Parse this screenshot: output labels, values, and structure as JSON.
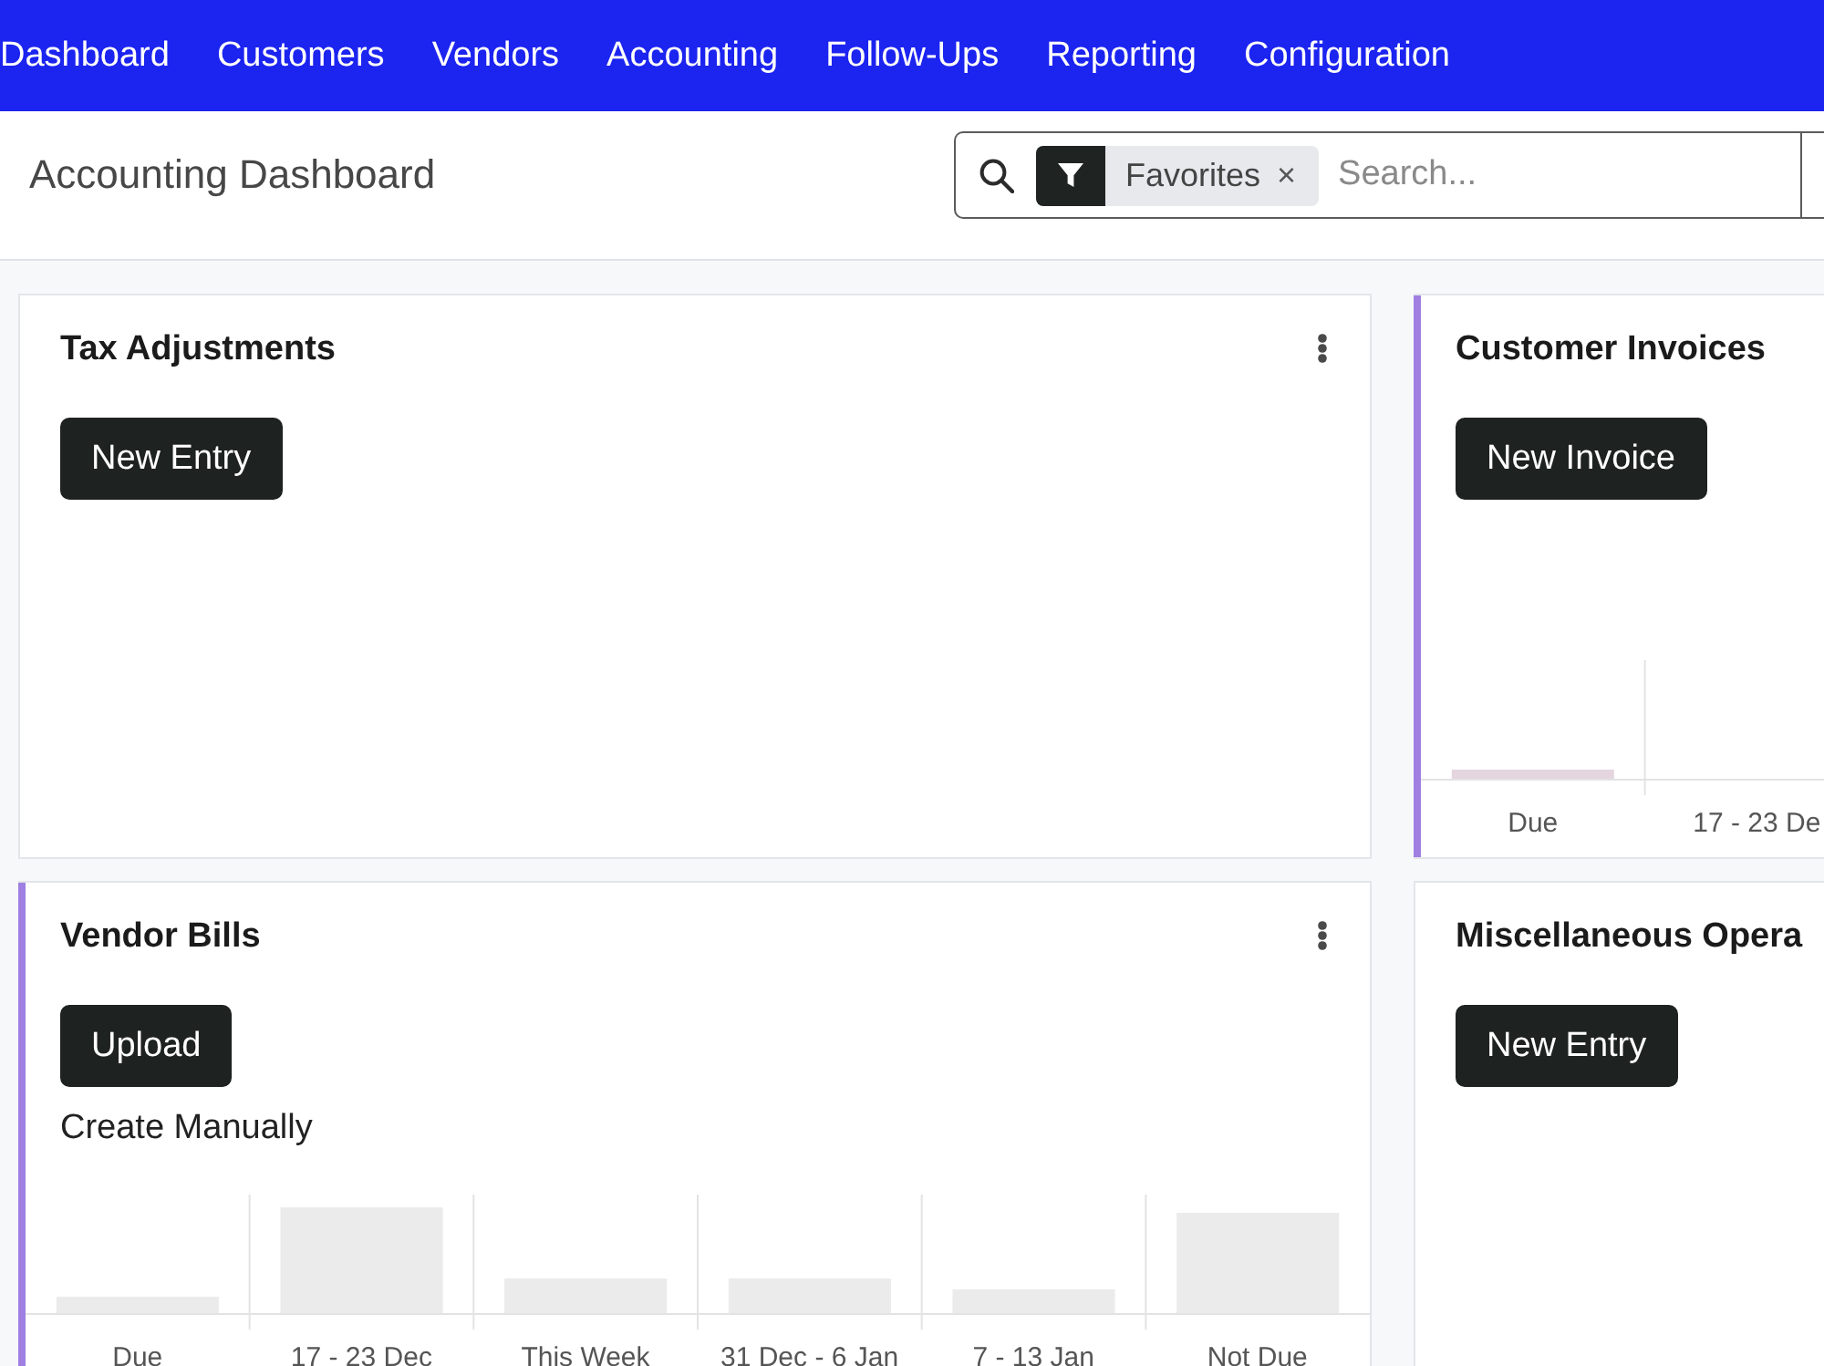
{
  "navbar": {
    "items": [
      "Dashboard",
      "Customers",
      "Vendors",
      "Accounting",
      "Follow-Ups",
      "Reporting",
      "Configuration"
    ]
  },
  "control_panel": {
    "title": "Accounting Dashboard",
    "search": {
      "facet": {
        "label": "Favorites",
        "remove": "×"
      },
      "placeholder": "Search..."
    }
  },
  "cards": [
    {
      "title": "Tax Adjustments",
      "has_menu": true,
      "button": "New Entry"
    },
    {
      "title": "Customer Invoices",
      "color": "#9f7fe1",
      "has_menu": false,
      "button": "New Invoice",
      "bar_labels": [
        "Due",
        "17 - 23 De"
      ]
    },
    {
      "title": "Vendor Bills",
      "color": "#9f7fe1",
      "has_menu": true,
      "button": "Upload",
      "link": "Create Manually",
      "bar_labels": [
        "Due",
        "17 - 23 Dec",
        "This Week",
        "31 Dec - 6 Jan",
        "7 - 13 Jan",
        "Not Due"
      ]
    },
    {
      "title": "Miscellaneous Opera",
      "has_menu": false,
      "button": "New Entry"
    }
  ]
}
